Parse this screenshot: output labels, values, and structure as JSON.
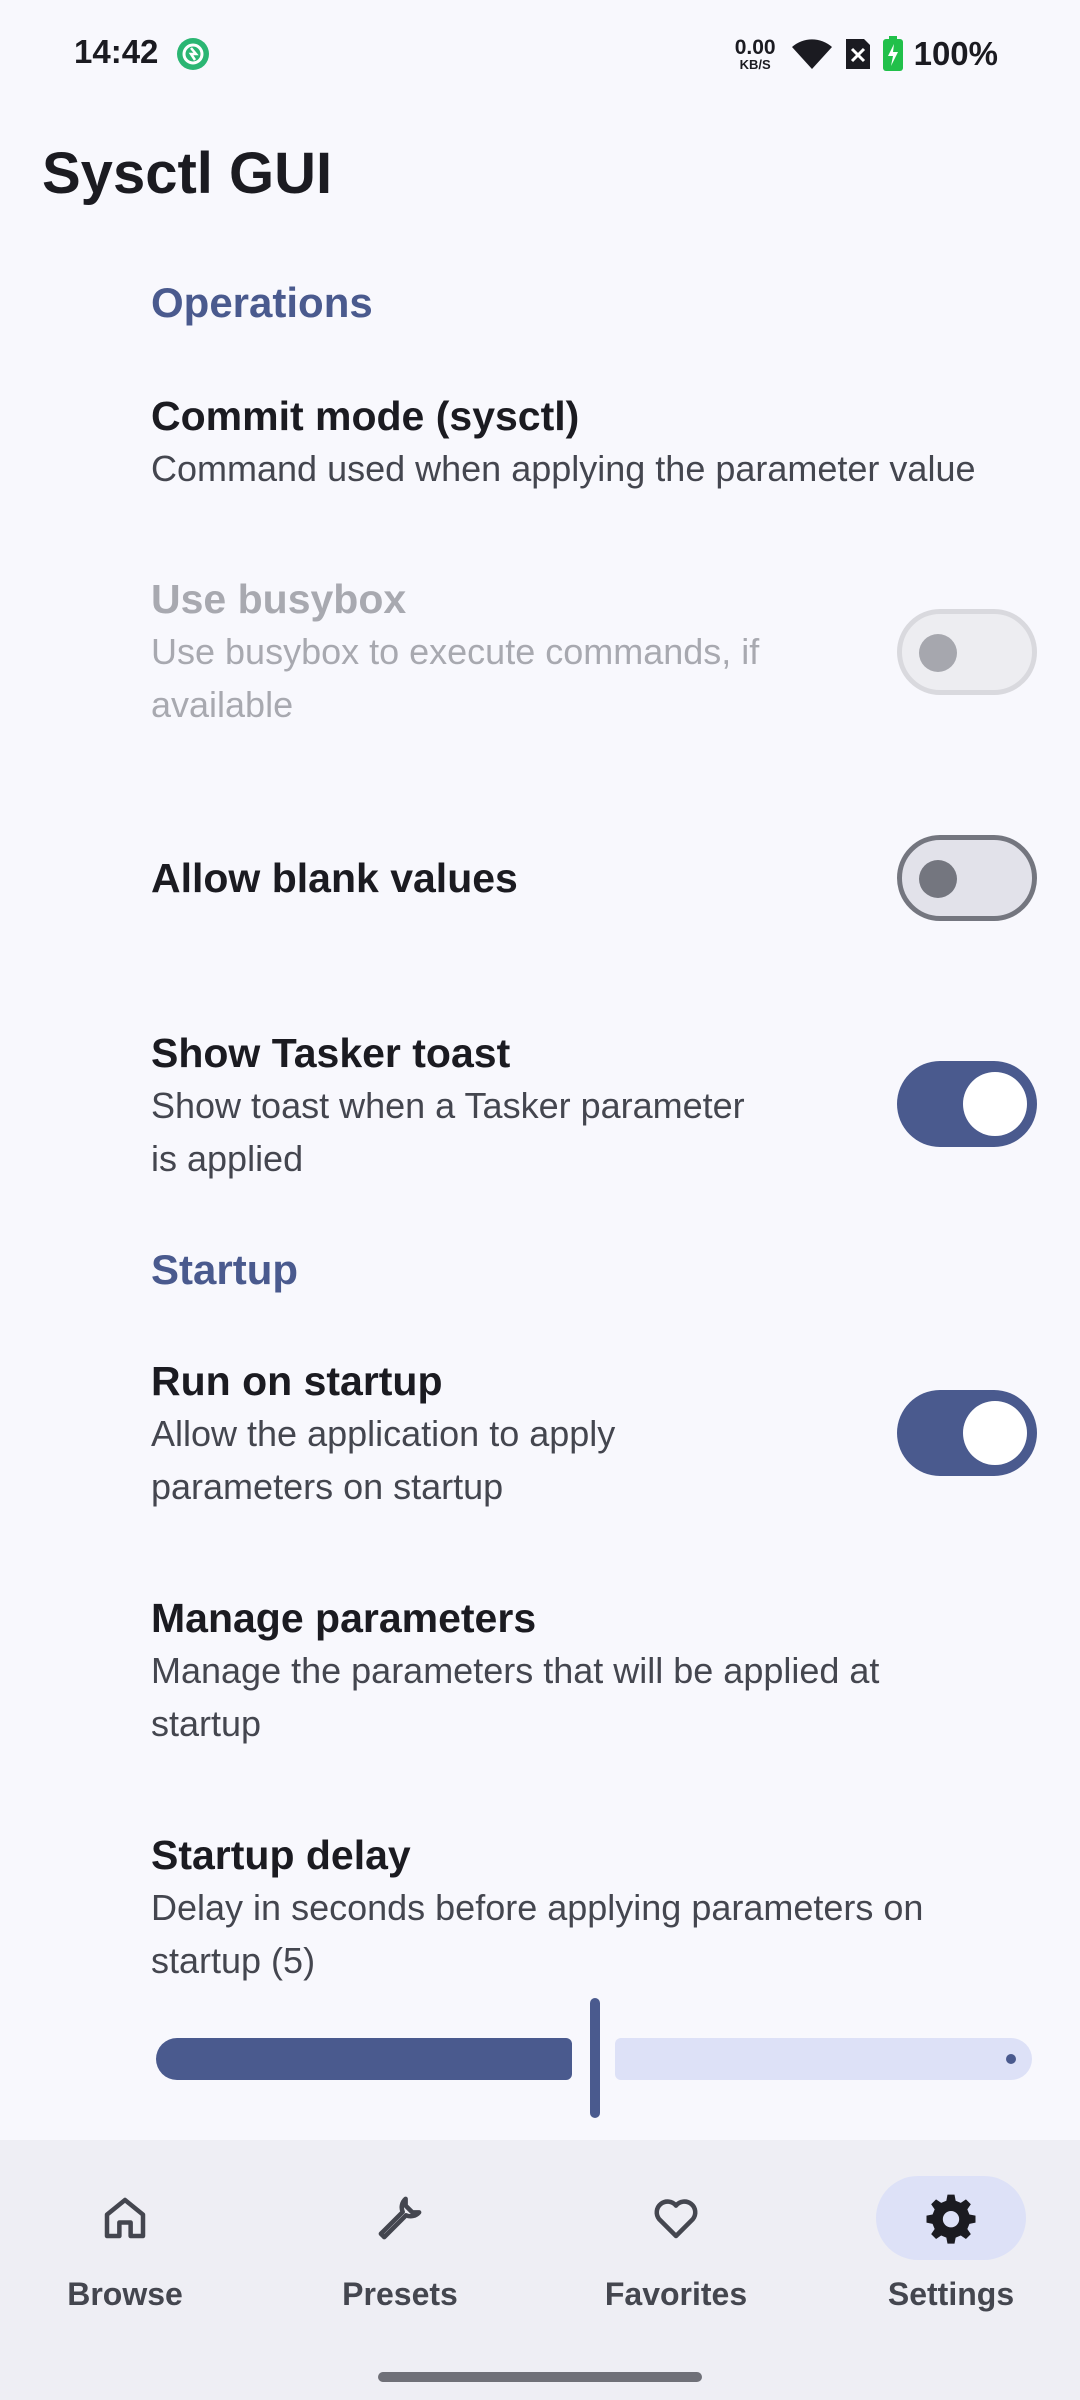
{
  "status_bar": {
    "time": "14:42",
    "net_speed_value": "0.00",
    "net_speed_unit": "KB/S",
    "battery": "100%",
    "icons": [
      "app-notification-icon",
      "wifi-icon",
      "no-sim-icon",
      "battery-charging-icon"
    ]
  },
  "app_bar": {
    "title": "Sysctl GUI"
  },
  "categories": {
    "operations": "Operations",
    "startup": "Startup"
  },
  "prefs": {
    "commit_mode": {
      "title": "Commit mode (sysctl)",
      "summary": "Command used when applying the parameter value"
    },
    "use_busybox": {
      "title": "Use busybox",
      "summary_l1": "Use busybox to execute commands, if",
      "summary_l2": "available",
      "checked": false,
      "enabled": false
    },
    "allow_blank": {
      "title": "Allow blank values",
      "checked": false
    },
    "tasker_toast": {
      "title": "Show Tasker toast",
      "summary_l1": "Show toast when a Tasker parameter",
      "summary_l2": "is applied",
      "checked": true
    },
    "run_on_startup": {
      "title": "Run on startup",
      "summary_l1": "Allow the application to apply",
      "summary_l2": "parameters on startup",
      "checked": true
    },
    "manage_params": {
      "title": "Manage parameters",
      "summary_l1": "Manage the parameters that will be applied at",
      "summary_l2": "startup"
    },
    "startup_delay": {
      "title": "Startup delay",
      "summary_l1": "Delay in seconds before applying parameters on",
      "summary_l2": "startup (5)",
      "slider_fraction": 0.5
    }
  },
  "bottom_nav": {
    "items": [
      {
        "label": "Browse",
        "icon": "home-icon",
        "active": false
      },
      {
        "label": "Presets",
        "icon": "wrench-icon",
        "active": false
      },
      {
        "label": "Favorites",
        "icon": "heart-icon",
        "active": false
      },
      {
        "label": "Settings",
        "icon": "gear-icon",
        "active": true
      }
    ]
  },
  "colors": {
    "accent": "#4a5a8e",
    "accent_container": "#dde1f7",
    "background": "#f8f8fd",
    "nav_background": "#eeeef4"
  }
}
